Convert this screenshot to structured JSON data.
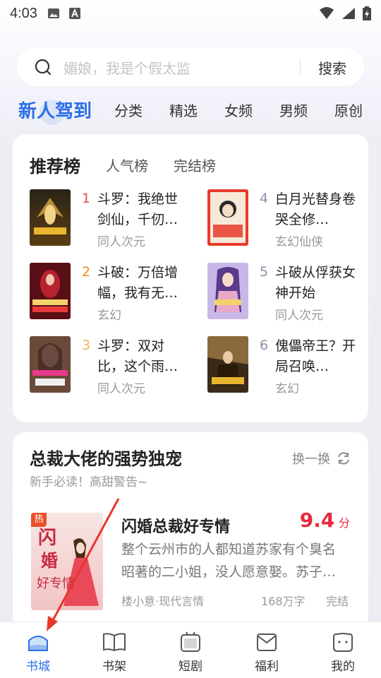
{
  "status_bar": {
    "time": "4:03"
  },
  "search": {
    "placeholder": "媚娘，我是个假太监",
    "button": "搜索"
  },
  "top_tabs": [
    "新人驾到",
    "分类",
    "精选",
    "女频",
    "男频",
    "原创"
  ],
  "ranking": {
    "tabs": [
      "推荐榜",
      "人气榜",
      "完结榜"
    ],
    "items": [
      {
        "rank": "1",
        "title": "斗罗：我绝世剑仙，千仞…",
        "tag": "同人次元",
        "rank_color": "#e84a4a"
      },
      {
        "rank": "2",
        "title": "斗破：万倍增幅，我有无…",
        "tag": "玄幻",
        "rank_color": "#f08a1c"
      },
      {
        "rank": "3",
        "title": "斗罗：双对比，这个雨…",
        "tag": "同人次元",
        "rank_color": "#f2b15a"
      },
      {
        "rank": "4",
        "title": "白月光替身卷哭全修…",
        "tag": "玄幻仙侠",
        "rank_color": "#8a8fa6"
      },
      {
        "rank": "5",
        "title": "斗破从俘获女神开始",
        "tag": "同人次元",
        "rank_color": "#8a8fa6"
      },
      {
        "rank": "6",
        "title": "傀儡帝王？开局召唤…",
        "tag": "玄幻",
        "rank_color": "#8a8fa6"
      }
    ]
  },
  "section": {
    "title": "总裁大佬的强势独宠",
    "refresh_label": "换一换",
    "subtitle": "新手必读！高甜警告~",
    "book": {
      "badge": "热",
      "title": "闪婚总裁好专情",
      "score": "9.4",
      "score_unit": "分",
      "description": "整个云州市的人都知道苏家有个臭名昭著的二小姐，没人愿意娶。苏子…",
      "author": "楼小意·现代言情",
      "word_count": "168万字",
      "status": "完结"
    }
  },
  "bottom_nav": [
    {
      "label": "书城",
      "icon": "bookstore-icon",
      "active": true
    },
    {
      "label": "书架",
      "icon": "bookshelf-icon",
      "active": false
    },
    {
      "label": "短剧",
      "icon": "short-drama-icon",
      "active": false
    },
    {
      "label": "福利",
      "icon": "welfare-icon",
      "active": false
    },
    {
      "label": "我的",
      "icon": "profile-icon",
      "active": false
    }
  ],
  "colors": {
    "accent": "#2a6ee8",
    "score": "#e8283d",
    "hot_badge": "#e8502b"
  }
}
